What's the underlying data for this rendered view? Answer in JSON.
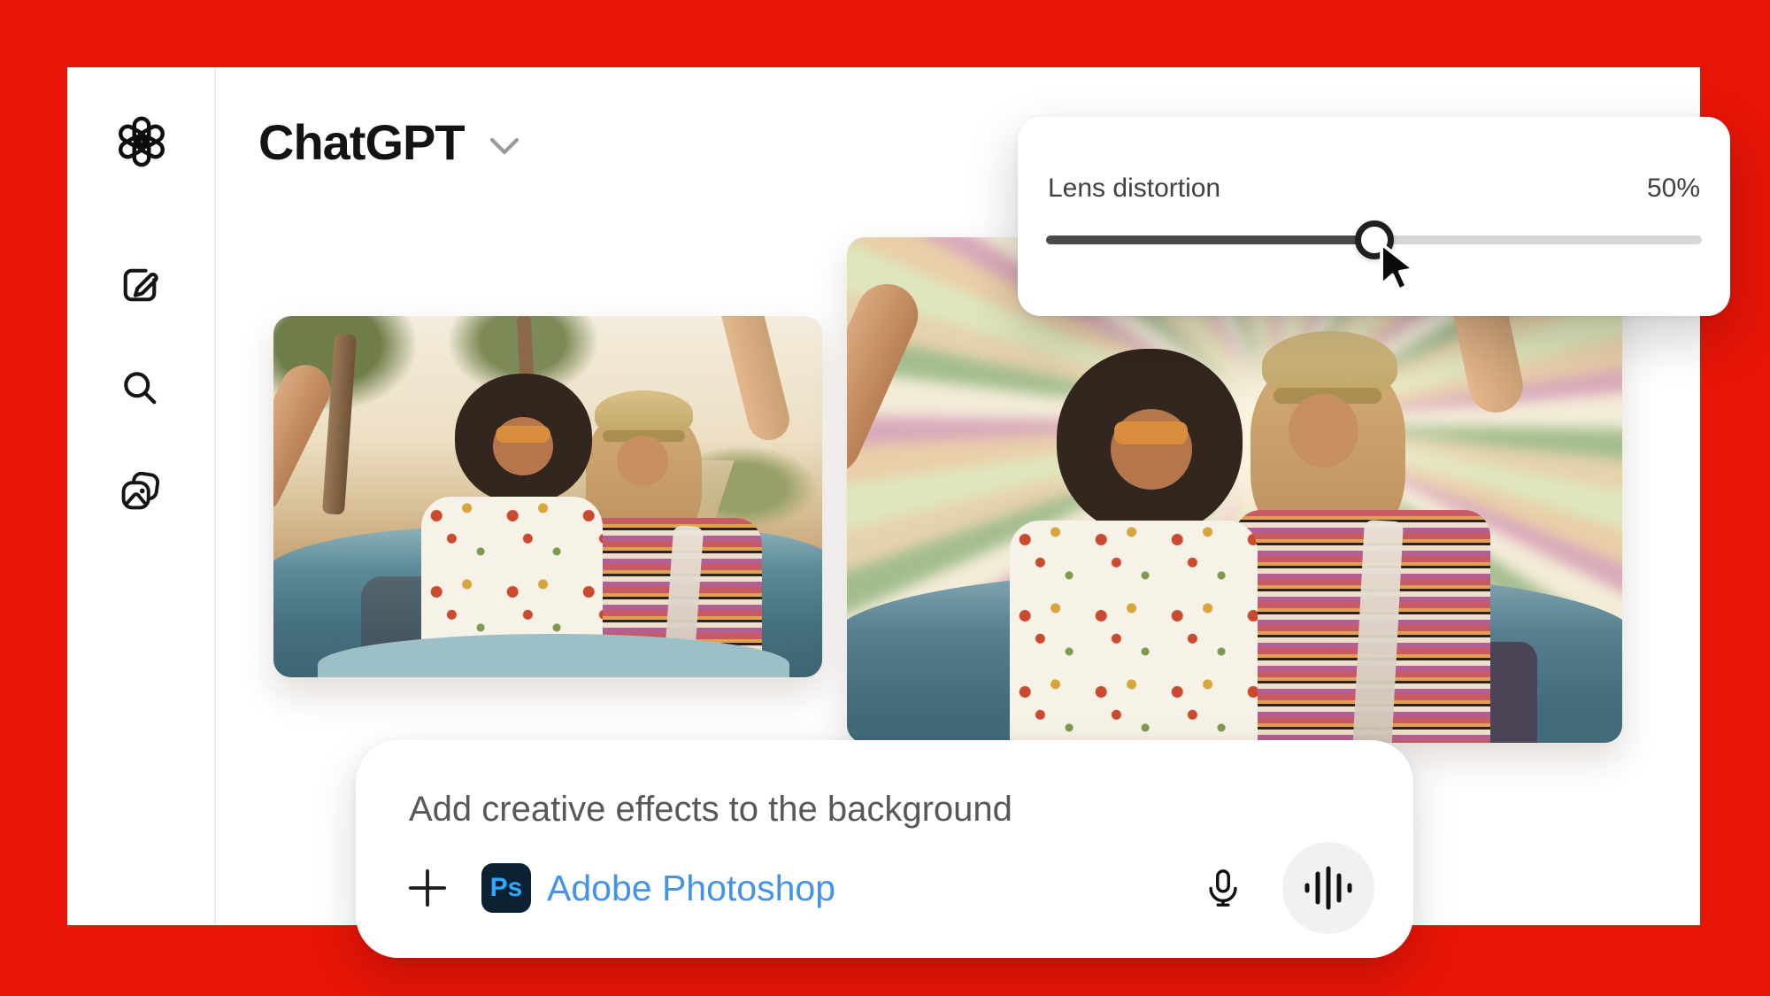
{
  "header": {
    "title": "ChatGPT",
    "caret_icon": "chevron-down-icon"
  },
  "sidebar": {
    "logo_icon": "openai-logo-icon",
    "items": [
      {
        "icon": "new-chat-icon"
      },
      {
        "icon": "search-icon"
      },
      {
        "icon": "image-library-icon"
      }
    ]
  },
  "lens_panel": {
    "label": "Lens distortion",
    "value": "50%",
    "slider_percent": 50
  },
  "composer": {
    "prompt": "Add creative effects to the background",
    "app_badge": "Ps",
    "app_name": "Adobe Photoshop",
    "icons": [
      "plus-icon",
      "microphone-icon",
      "voice-waveform-icon"
    ]
  },
  "cursor": {
    "icon": "mouse-pointer-icon"
  },
  "colors": {
    "background_red": "#e61507",
    "window_white": "#ffffff",
    "divider": "#ededed",
    "title_text": "#131313",
    "label_text": "#414141",
    "muted_text": "#585858",
    "link_blue": "#4593e8",
    "ps_badge_bg": "#0c2233",
    "ps_badge_fg": "#31a8ff",
    "slider_fill": "#4a4a4a",
    "slider_track": "#d6d6d6",
    "wave_button_bg": "#f1f1f1"
  }
}
